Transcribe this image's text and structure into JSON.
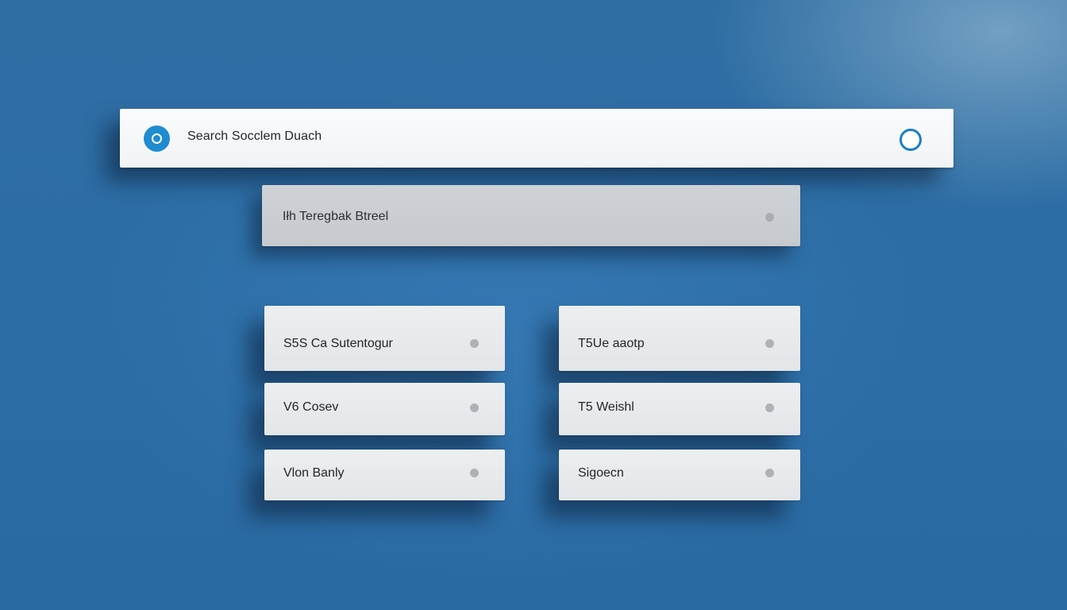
{
  "search": {
    "text": "Search Socclem Duach",
    "left_icon": "circle-icon",
    "right_icon": "ring-icon"
  },
  "filter": {
    "text": "Iłh Teregbak Btreel"
  },
  "options": [
    {
      "label": "S5S Ca Sutentogur"
    },
    {
      "label": "T5Ue aaotp"
    },
    {
      "label": "V6  Cosev"
    },
    {
      "label": "T5  Weishl"
    },
    {
      "label": "Vlon Banly"
    },
    {
      "label": "Sigoecn"
    }
  ],
  "colors": {
    "accent": "#1f8bd0",
    "background": "#2c6da5"
  }
}
